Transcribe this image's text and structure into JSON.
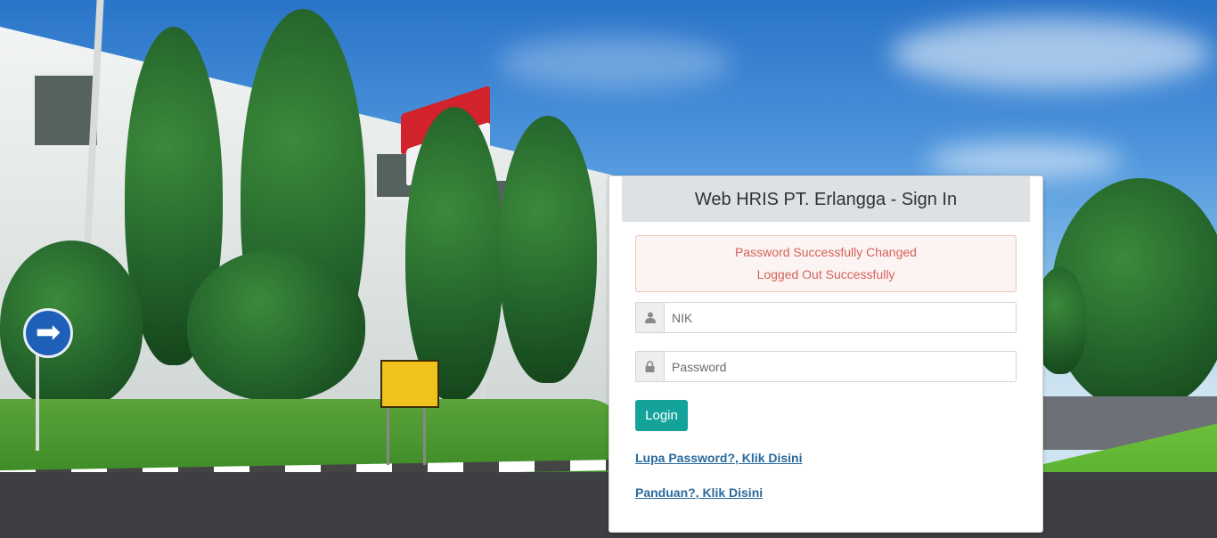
{
  "panel": {
    "title": "Web HRIS PT. Erlangga - Sign In"
  },
  "alerts": {
    "line1": "Password Successfully Changed",
    "line2": "Logged Out Successfully"
  },
  "form": {
    "nik_placeholder": "NIK",
    "password_placeholder": "Password",
    "user_icon": "user-icon",
    "lock_icon": "lock-icon",
    "login_label": "Login"
  },
  "links": {
    "forgot": "Lupa Password?, Klik Disini",
    "guide": "Panduan?, Klik Disini"
  },
  "colors": {
    "accent": "#13a39a",
    "alert_text": "#d4625a",
    "link": "#2a6a9c"
  }
}
